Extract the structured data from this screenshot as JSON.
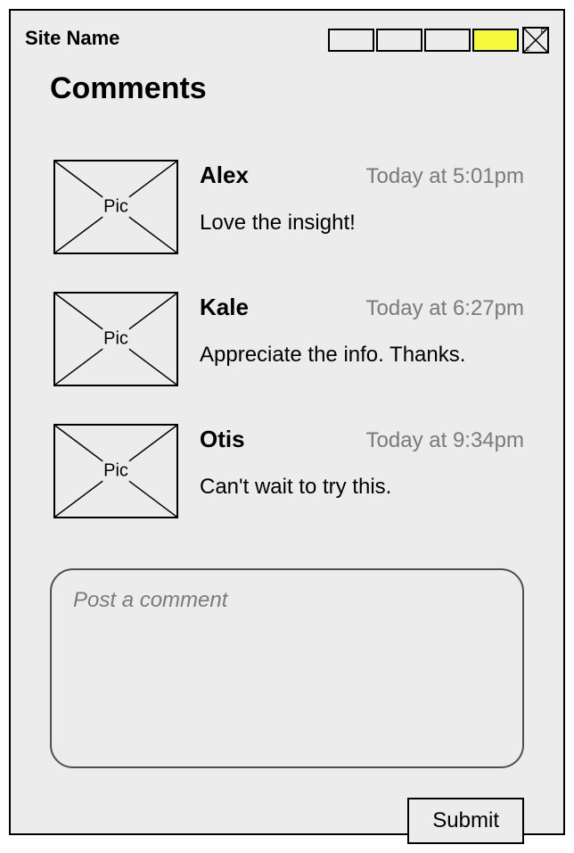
{
  "header": {
    "site_name": "Site Name",
    "nav_items": [
      {
        "active": false
      },
      {
        "active": false
      },
      {
        "active": false
      },
      {
        "active": true
      }
    ]
  },
  "page": {
    "title": "Comments"
  },
  "comments": [
    {
      "pic_label": "Pic",
      "author": "Alex",
      "timestamp": "Today at 5:01pm",
      "text": "Love the insight!"
    },
    {
      "pic_label": "Pic",
      "author": "Kale",
      "timestamp": "Today at 6:27pm",
      "text": "Appreciate the info. Thanks."
    },
    {
      "pic_label": "Pic",
      "author": "Otis",
      "timestamp": "Today at 9:34pm",
      "text": "Can't wait to try this."
    }
  ],
  "compose": {
    "placeholder": "Post a comment",
    "submit_label": "Submit"
  }
}
